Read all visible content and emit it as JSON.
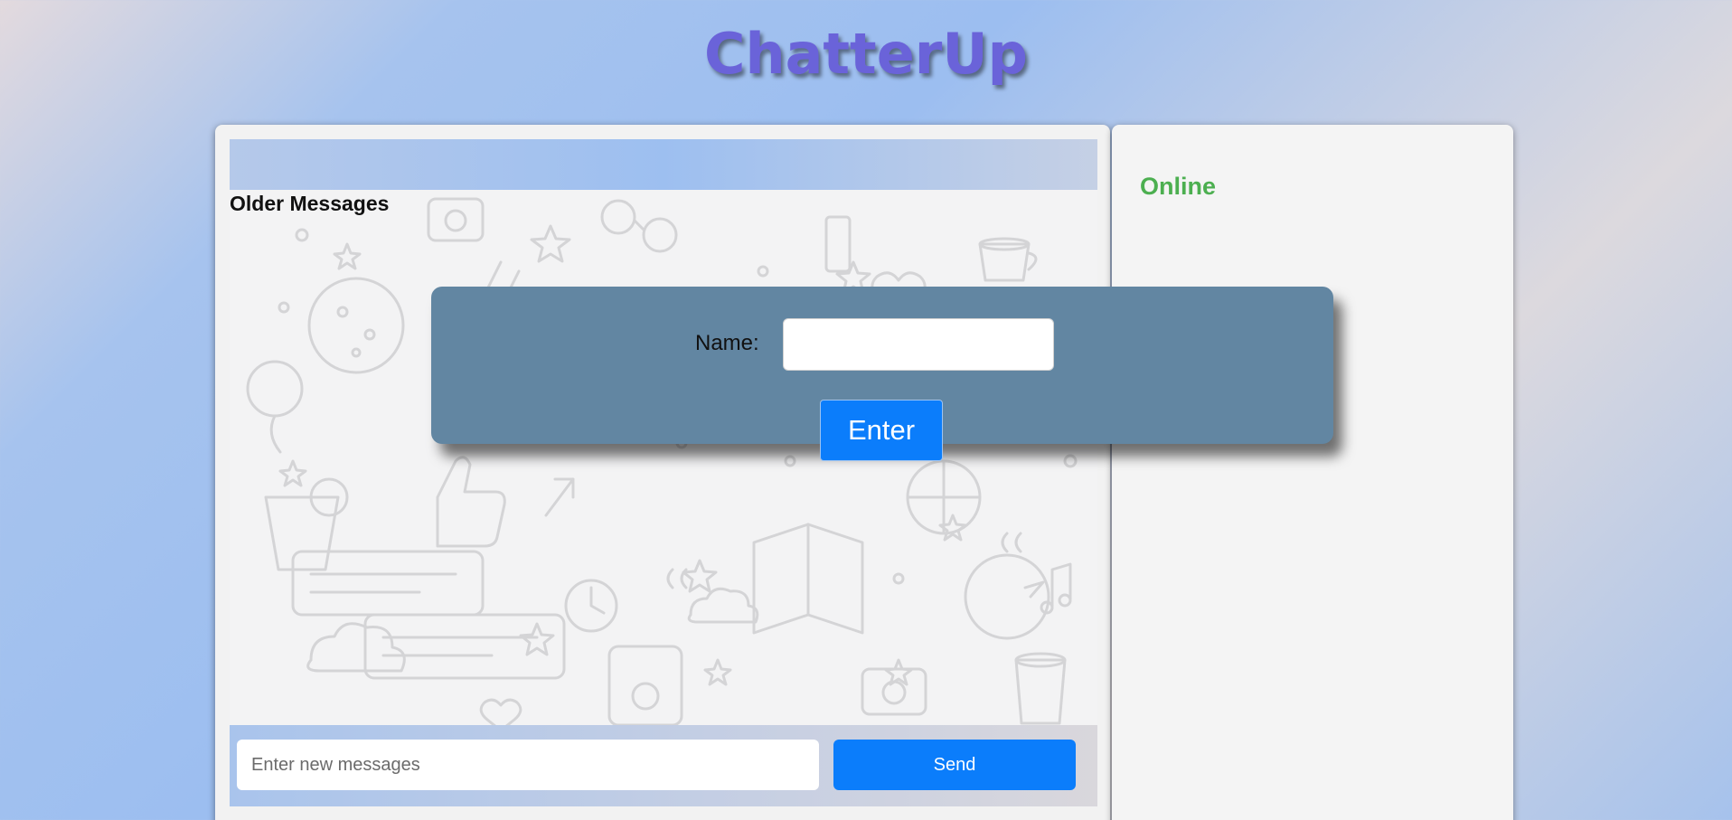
{
  "app": {
    "title": "ChatterUp"
  },
  "chat": {
    "older_messages_label": "Older Messages",
    "compose": {
      "placeholder": "Enter new messages",
      "value": "",
      "send_label": "Send"
    }
  },
  "online": {
    "title": "Online"
  },
  "name_modal": {
    "label": "Name:",
    "input_value": "",
    "enter_label": "Enter"
  },
  "colors": {
    "title": "#6a63d9",
    "accent_button": "#0b7dfb",
    "online_green": "#4caf50",
    "modal_bg": "#6286a2"
  }
}
